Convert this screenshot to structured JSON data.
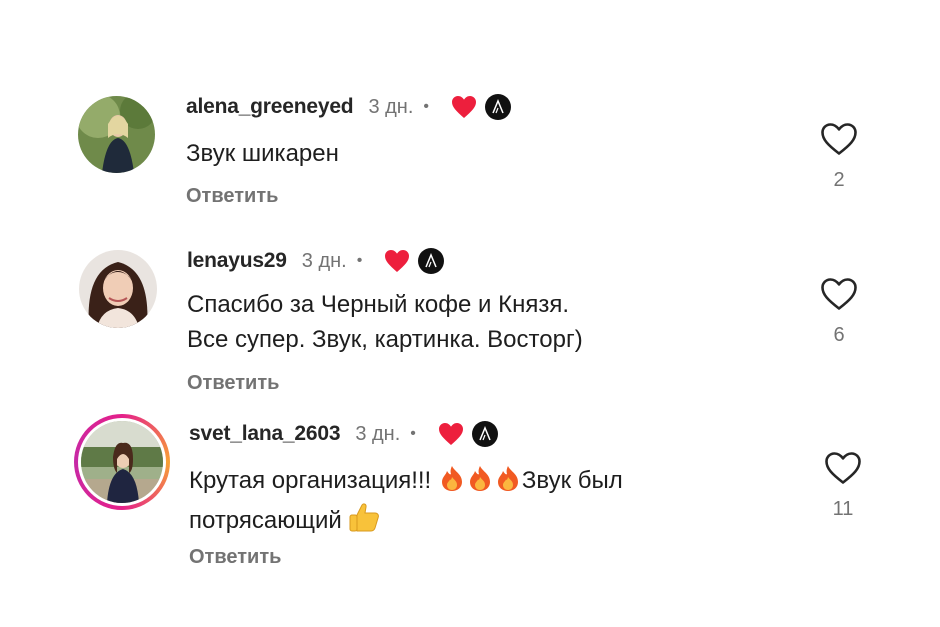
{
  "comments": [
    {
      "username": "alena_greeneyed",
      "time": "3 дн.",
      "separator": "•",
      "lines": [
        "Звук шикарен"
      ],
      "reply_label": "Ответить",
      "like_count": "2",
      "story_ring": false
    },
    {
      "username": "lenayus29",
      "time": "3 дн.",
      "separator": "•",
      "lines": [
        "Спасибо за Черный кофе и Князя.",
        "Все супер. Звук, картинка. Восторг)"
      ],
      "reply_label": "Ответить",
      "like_count": "6",
      "story_ring": false
    },
    {
      "username": "svet_lana_2603",
      "time": "3 дн.",
      "separator": "•",
      "line1_before": "Крутая организация!!! ",
      "line1_after": "Звук был",
      "line2": "потрясающий ",
      "reply_label": "Ответить",
      "like_count": "11",
      "story_ring": true
    }
  ],
  "icons": {
    "creator_heart": "red-heart-icon",
    "brand_badge": "brand-logo-icon",
    "like": "heart-outline-icon",
    "fire": "fire-emoji",
    "thumbs_up": "thumbs-up-emoji"
  },
  "colors": {
    "creator_heart": "#ed1f3d",
    "muted_text": "#737373",
    "story_ring": "#e4208a"
  }
}
